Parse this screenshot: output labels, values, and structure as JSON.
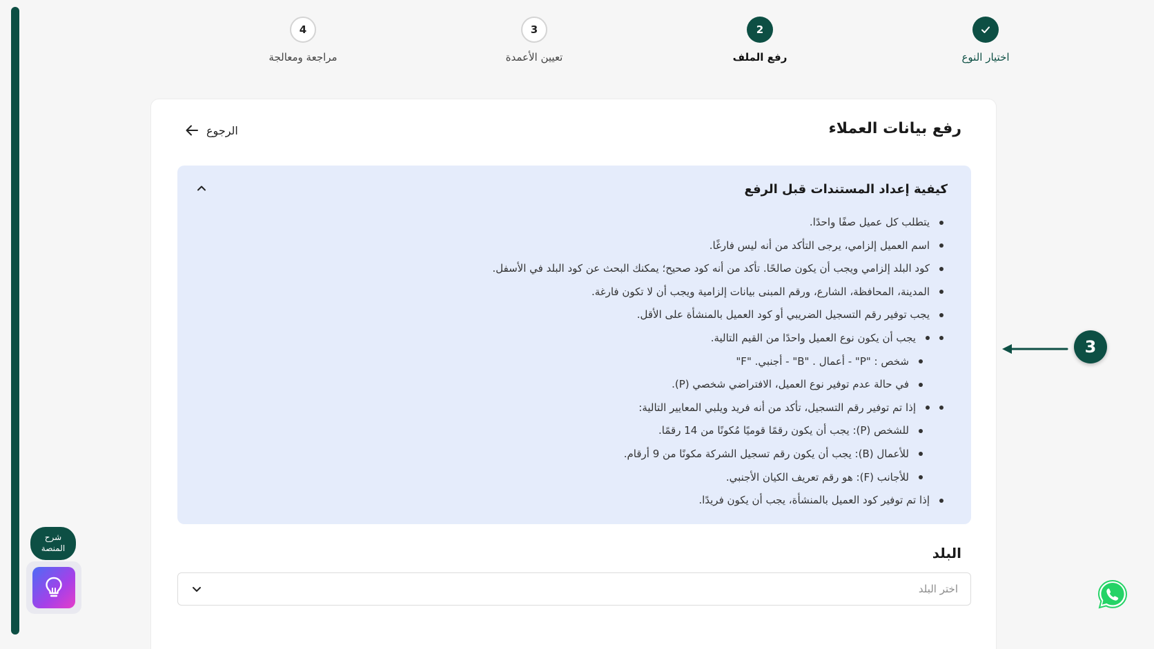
{
  "stepper": {
    "steps": [
      {
        "label": "اختيار النوع",
        "number": "✓",
        "state": "done"
      },
      {
        "label": "رفع الملف",
        "number": "2",
        "state": "active"
      },
      {
        "label": "تعيين الأعمدة",
        "number": "3",
        "state": "pending"
      },
      {
        "label": "مراجعة ومعالجة",
        "number": "4",
        "state": "pending"
      }
    ]
  },
  "card": {
    "title": "رفع بيانات العملاء",
    "back_label": "الرجوع"
  },
  "instructions": {
    "title": "كيفية إعداد المستندات قبل الرفع",
    "items": [
      "يتطلب كل عميل صفًا واحدًا.",
      "اسم العميل إلزامي، يرجى التأكد من أنه ليس فارغًا.",
      "كود البلد إلزامي ويجب أن يكون صالحًا. تأكد من أنه كود صحيح؛ يمكنك البحث عن كود البلد في الأسفل.",
      "المدينة، المحافظة، الشارع، ورقم المبنى بيانات إلزامية ويجب أن لا تكون فارغة.",
      "يجب توفير رقم التسجيل الضريبي أو كود العميل بالمنشأة على الأقل.",
      "يجب أن يكون نوع العميل واحدًا من القيم التالية.",
      "شخص : \"P\"  -  أعمال . \"B\"  -  أجنبي. \"F\"",
      "في حالة عدم توفير نوع العميل، الافتراضي شخصي (P).",
      "إذا تم توفير رقم التسجيل، تأكد من أنه فريد ويلبي المعايير التالية:",
      "للشخص (P): يجب أن يكون رقمًا قوميًا مُكونًا من 14 رقمًا.",
      "للأعمال (B): يجب أن يكون رقم تسجيل الشركة مكونًا من 9 أرقام.",
      "للأجانب (F): هو رقم تعريف الكيان الأجنبي.",
      "إذا تم توفير كود العميل بالمنشأة، يجب أن يكون فريدًا."
    ]
  },
  "country": {
    "label": "البلد",
    "placeholder": "اختر البلد"
  },
  "annotation": {
    "number": "3"
  },
  "help": {
    "label_line1": "شرح",
    "label_line2": "المنصة"
  },
  "colors": {
    "primary": "#0d4f44",
    "info_bg": "#e5ecfb",
    "whatsapp": "#25d366"
  }
}
